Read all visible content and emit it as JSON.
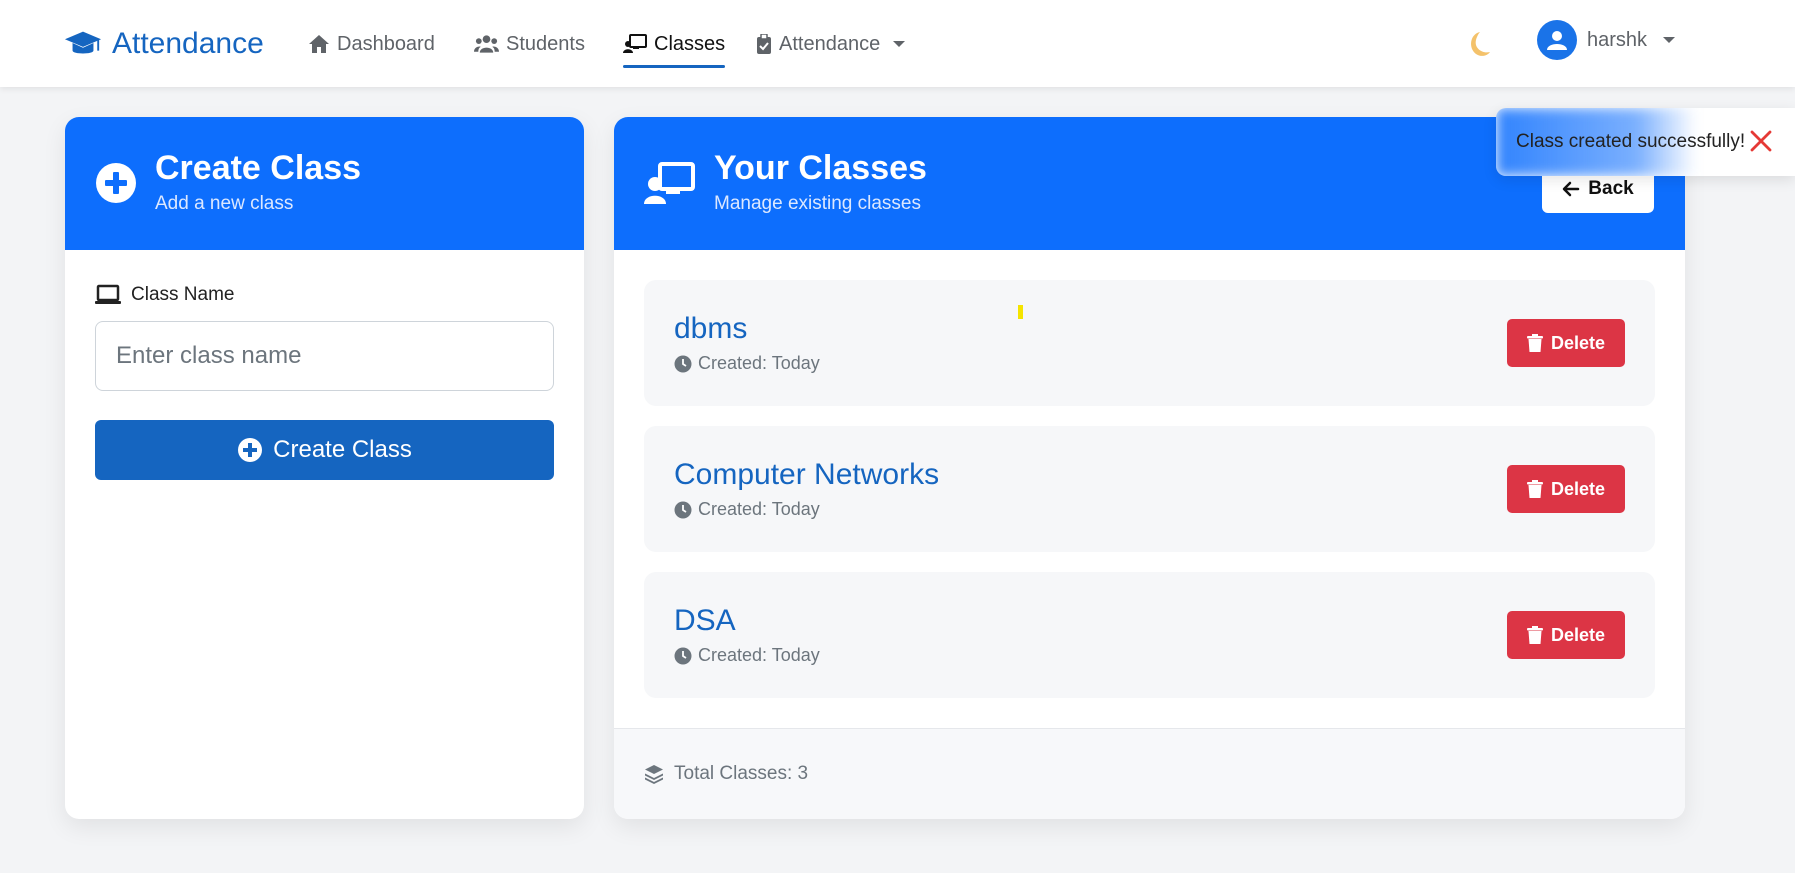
{
  "navbar": {
    "brand": "Attendance",
    "links": [
      {
        "label": "Dashboard",
        "icon": "home-icon"
      },
      {
        "label": "Students",
        "icon": "users-icon"
      },
      {
        "label": "Classes",
        "icon": "classroom-icon",
        "active": true
      },
      {
        "label": "Attendance",
        "icon": "clipboard-check-icon",
        "dropdown": true
      }
    ],
    "theme_toggle_icon": "moon-icon",
    "user": {
      "name": "harshk",
      "icon": "user-icon"
    }
  },
  "create_card": {
    "title": "Create Class",
    "subtitle": "Add a new class",
    "field_label": "Class Name",
    "input_placeholder": "Enter class name",
    "input_value": "",
    "button_label": "Create Class"
  },
  "classes_card": {
    "title": "Your Classes",
    "subtitle": "Manage existing classes",
    "back_label": "Back",
    "items": [
      {
        "name": "dbms",
        "meta": "Created: Today",
        "delete_label": "Delete"
      },
      {
        "name": "Computer Networks",
        "meta": "Created: Today",
        "delete_label": "Delete"
      },
      {
        "name": "DSA",
        "meta": "Created: Today",
        "delete_label": "Delete"
      }
    ],
    "footer": "Total Classes: 3"
  },
  "toast": {
    "message": "Class created successfully!"
  },
  "colors": {
    "primary": "#0d6efd",
    "brand": "#1565c0",
    "danger": "#dc3545",
    "background": "#f3f4f6"
  }
}
